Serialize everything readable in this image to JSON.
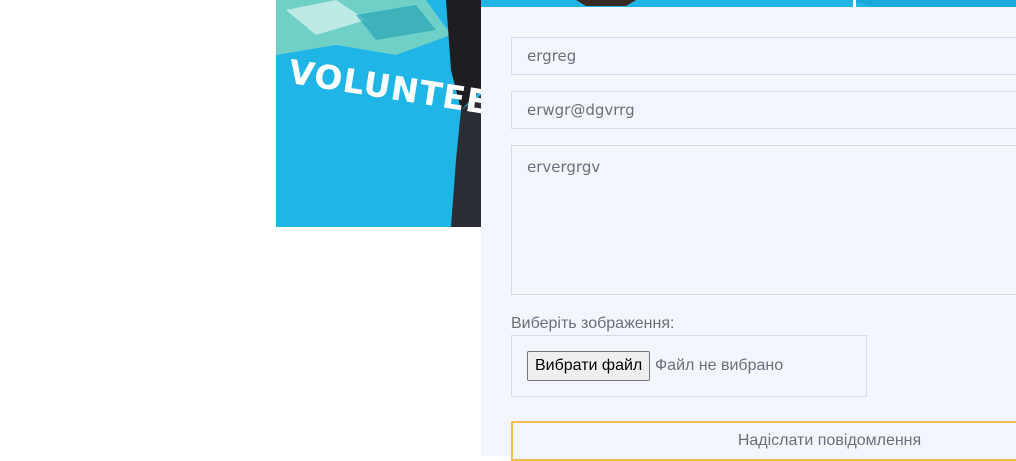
{
  "photo": {
    "shirt_text": "VOLUNTEER"
  },
  "form": {
    "name_value": "ergreg",
    "email_value": "erwgr@dgvrrg",
    "message_value": "ervergrgv",
    "file_label": "Виберіть зображення:",
    "file_button": "Вибрати файл",
    "file_status": "Файл не вибрано",
    "submit_label": "Надіслати повідомлення"
  },
  "colors": {
    "panel_bg": "#f3f6fe",
    "field_border": "#d8dbe3",
    "submit_border": "#f2bd48",
    "photo_blue": "#1fb5e6"
  }
}
